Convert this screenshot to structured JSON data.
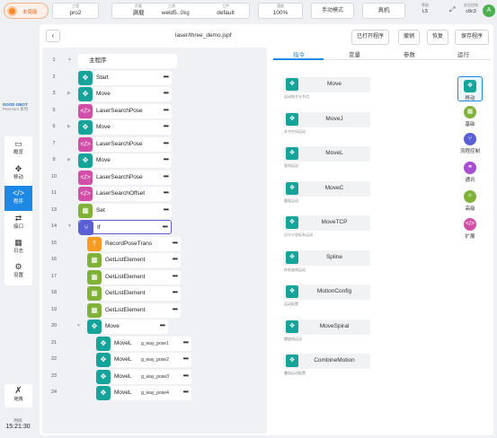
{
  "topbar": {
    "enable_label": "未使能",
    "engineering_label": "工程",
    "engineering_value": "pro2",
    "load_label": "负载",
    "load_value": "满载",
    "tool_label": "工具",
    "tool_value": "weld5...",
    "tool_weight": "0kg",
    "workpiece_label": "工件",
    "workpiece_value": "default",
    "speed_label": "速度",
    "speed_value": "100%",
    "mode_label": "手动模式",
    "real_label": "真机",
    "level_label": "等级",
    "level_value": "L5",
    "safety_label": "安全控制",
    "safety_value": "c8c3",
    "avatar": "A"
  },
  "sidebar": {
    "logo_line1": "DOOD OBOT",
    "logo_line2": "Premium 系列",
    "items": [
      {
        "label": "概览"
      },
      {
        "label": "移动"
      },
      {
        "label": "程序"
      },
      {
        "label": "接口"
      },
      {
        "label": "日志"
      },
      {
        "label": "设置"
      }
    ],
    "tool_label": "拖拽",
    "time_label": "时间",
    "time_value": "15:21:30"
  },
  "header": {
    "filename": "laser/three_demo.jspf",
    "open_label": "已打开程序",
    "undo_label": "撤销",
    "redo_label": "恢复",
    "save_label": "保存程序"
  },
  "program": {
    "rows": [
      {
        "n": "1",
        "label": "主程序",
        "color": "none"
      },
      {
        "n": "2",
        "label": "Start",
        "color": "teal"
      },
      {
        "n": "3",
        "label": "Move",
        "color": "teal"
      },
      {
        "n": "4",
        "label": "LaserSearchPose",
        "color": "pink"
      },
      {
        "n": "5",
        "label": "Move",
        "color": "teal"
      },
      {
        "n": "6",
        "label": "LaserSearchPose",
        "color": "pink"
      },
      {
        "n": "7",
        "label": "Move",
        "color": "teal"
      },
      {
        "n": "8",
        "label": "LaserSearchPose",
        "color": "pink"
      },
      {
        "n": "9",
        "label": "LaserSearchOffset",
        "color": "pink"
      },
      {
        "n": "10",
        "label": "Set",
        "color": "olive"
      },
      {
        "n": "11",
        "label": "If",
        "color": "indigo"
      },
      {
        "n": "12",
        "label": "RecordPoseTrans",
        "color": "orange"
      },
      {
        "n": "13",
        "label": "GetListElement",
        "color": "olive"
      },
      {
        "n": "14",
        "label": "GetListElement",
        "color": "olive"
      },
      {
        "n": "15",
        "label": "GetListElement",
        "color": "olive"
      },
      {
        "n": "16",
        "label": "GetListElement",
        "color": "olive"
      },
      {
        "n": "17",
        "label": "Move",
        "color": "teal"
      },
      {
        "n": "18",
        "label": "MoveL",
        "arg": "g_way_pose1",
        "color": "teal"
      },
      {
        "n": "19",
        "label": "MoveL",
        "arg": "g_way_pose2",
        "color": "teal"
      },
      {
        "n": "20",
        "label": "MoveL",
        "arg": "g_way_pose3",
        "color": "teal"
      },
      {
        "n": "21",
        "label": "MoveL",
        "arg": "g_way_pose4",
        "color": "teal"
      }
    ],
    "line_numbers": [
      "1",
      "2",
      "3",
      "5",
      "6",
      "7",
      "9",
      "10",
      "11",
      "13",
      "14",
      "15",
      "16",
      "17",
      "18",
      "19",
      "20",
      "21",
      "22",
      "23",
      "24"
    ]
  },
  "panel": {
    "tabs": [
      "指令",
      "变量",
      "参数",
      "运行"
    ],
    "commands": [
      {
        "name": "Move",
        "desc": "运动指令父节点"
      },
      {
        "name": "MoveJ",
        "desc": "关节空间运动"
      },
      {
        "name": "MoveL",
        "desc": "直线运动"
      },
      {
        "name": "MoveC",
        "desc": "圆弧运动"
      },
      {
        "name": "MoveTCP",
        "desc": "沿TCP坐标系运动"
      },
      {
        "name": "Spline",
        "desc": "样条曲线运动"
      },
      {
        "name": "MotionConfig",
        "desc": "运动配置"
      },
      {
        "name": "MoveSpiral",
        "desc": "螺旋线运动"
      },
      {
        "name": "CombineMotion",
        "desc": "叠加运动配置"
      }
    ],
    "categories": [
      {
        "label": "移动",
        "color": "#16a39a"
      },
      {
        "label": "基础",
        "color": "#7fb237"
      },
      {
        "label": "流程控制",
        "color": "#5a5fd6"
      },
      {
        "label": "通讯",
        "color": "#a64fd2"
      },
      {
        "label": "高级",
        "color": "#7fb237"
      },
      {
        "label": "扩展",
        "color": "#d24fa8"
      }
    ]
  }
}
